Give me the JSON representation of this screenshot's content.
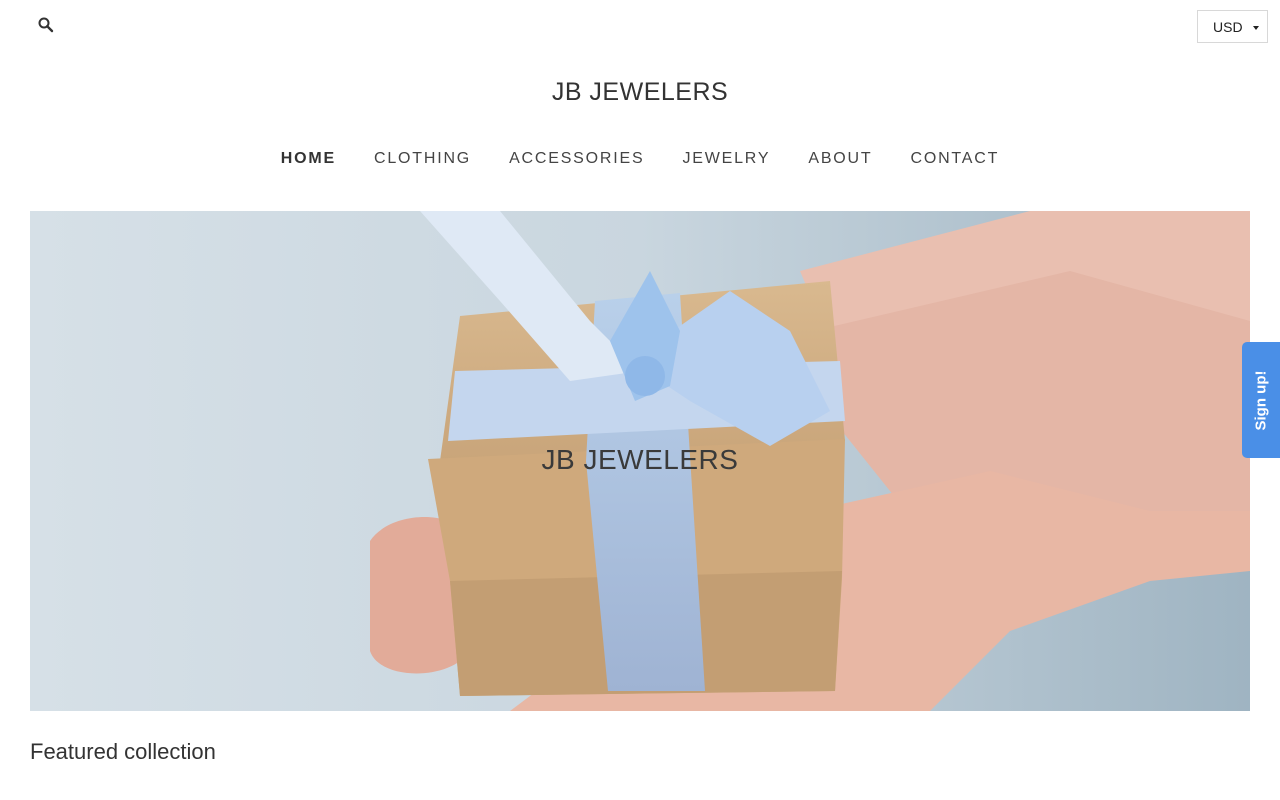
{
  "header": {
    "search_icon": "search-icon",
    "currency": {
      "selected": "USD"
    },
    "logo": "JB JEWELERS"
  },
  "nav": {
    "items": [
      {
        "label": "HOME",
        "active": true
      },
      {
        "label": "CLOTHING",
        "active": false
      },
      {
        "label": "ACCESSORIES",
        "active": false
      },
      {
        "label": "JEWELRY",
        "active": false
      },
      {
        "label": "ABOUT",
        "active": false
      },
      {
        "label": "CONTACT",
        "active": false
      }
    ]
  },
  "hero": {
    "title": "JB JEWELERS",
    "image_subject": "hands holding kraft gift box with light blue ribbon"
  },
  "signup_tab": {
    "label": "Sign up!",
    "color": "#4a8fe7"
  },
  "featured": {
    "heading": "Featured collection"
  }
}
